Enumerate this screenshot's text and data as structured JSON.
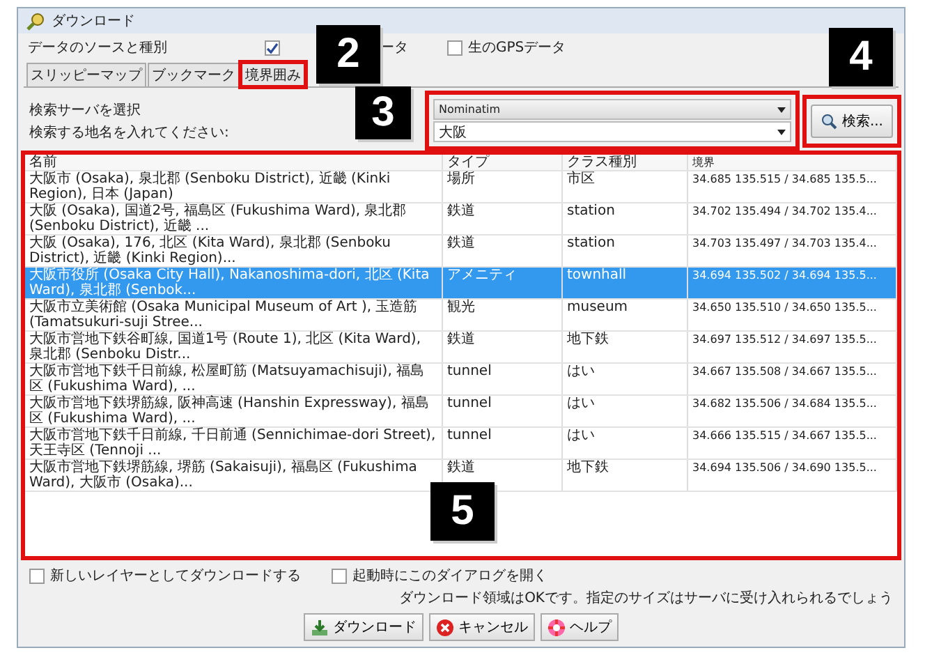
{
  "window": {
    "title": "ダウンロード"
  },
  "source": {
    "label": "データのソースと種別",
    "options": [
      {
        "label": "ータ",
        "checked": true
      },
      {
        "label": "生のGPSデータ",
        "checked": false
      }
    ]
  },
  "tabs": [
    {
      "label": "スリッピーマップ",
      "selected": false,
      "highlighted": false
    },
    {
      "label": "ブックマーク",
      "selected": false,
      "highlighted": false
    },
    {
      "label": "境界囲み",
      "selected": false,
      "highlighted": true
    }
  ],
  "search": {
    "server_label": "検索サーバを選択",
    "query_label": "検索する地名を入れてください:",
    "server": "Nominatim",
    "query": "大阪",
    "highlighted": true
  },
  "search_button": {
    "label": "検索...",
    "highlighted": true
  },
  "table": {
    "highlighted": true,
    "columns": [
      "名前",
      "タイプ",
      "クラス種別",
      "境界"
    ],
    "rows": [
      {
        "cells": [
          "大阪市 (Osaka), 泉北郡 (Senboku District), 近畿 (Kinki Region), 日本 (Japan)",
          "場所",
          "市区",
          "34.685 135.515 / 34.685 135.5..."
        ],
        "selected": false
      },
      {
        "cells": [
          "大阪 (Osaka), 国道2号, 福島区 (Fukushima Ward), 泉北郡 (Senboku District), 近畿 ...",
          "鉄道",
          "station",
          "34.702 135.494 / 34.702 135.4..."
        ],
        "selected": false
      },
      {
        "cells": [
          "大阪 (Osaka), 176, 北区 (Kita Ward), 泉北郡 (Senboku District), 近畿 (Kinki Region)...",
          "鉄道",
          "station",
          "34.703 135.497 / 34.703 135.4..."
        ],
        "selected": false
      },
      {
        "cells": [
          "大阪市役所 (Osaka City Hall), Nakanoshima-dori, 北区 (Kita Ward), 泉北郡 (Senbok...",
          "アメニティ",
          "townhall",
          "34.694 135.502 / 34.694 135.5..."
        ],
        "selected": true
      },
      {
        "cells": [
          "大阪市立美術館 (Osaka Municipal Museum of Art ), 玉造筋 (Tamatsukuri-suji Stree...",
          "観光",
          "museum",
          "34.650 135.510 / 34.650 135.5..."
        ],
        "selected": false
      },
      {
        "cells": [
          "大阪市営地下鉄谷町線, 国道1号 (Route 1), 北区 (Kita Ward), 泉北郡 (Senboku Distr...",
          "鉄道",
          "地下鉄",
          "34.697 135.512 / 34.697 135.5..."
        ],
        "selected": false
      },
      {
        "cells": [
          "大阪市営地下鉄千日前線, 松屋町筋 (Matsuyamachisuji), 福島区 (Fukushima Ward), ...",
          "tunnel",
          "はい",
          "34.667 135.508 / 34.667 135.5..."
        ],
        "selected": false
      },
      {
        "cells": [
          "大阪市営地下鉄堺筋線, 阪神高速 (Hanshin Expressway), 福島区 (Fukushima Ward), ...",
          "tunnel",
          "はい",
          "34.682 135.506 / 34.684 135.5..."
        ],
        "selected": false
      },
      {
        "cells": [
          "大阪市営地下鉄千日前線, 千日前通 (Sennichimae-dori Street), 天王寺区 (Tennoji ...",
          "tunnel",
          "はい",
          "34.666 135.515 / 34.667 135.5..."
        ],
        "selected": false
      },
      {
        "cells": [
          "大阪市営地下鉄堺筋線, 堺筋 (Sakaisuji), 福島区 (Fukushima Ward), 大阪市 (Osaka)...",
          "鉄道",
          "地下鉄",
          "34.694 135.506 / 34.690 135.5..."
        ],
        "selected": false
      }
    ]
  },
  "options": [
    {
      "label": "新しいレイヤーとしてダウンロードする",
      "checked": false
    },
    {
      "label": "起動時にこのダイアログを開く",
      "checked": false
    }
  ],
  "status": "ダウンロード領域はOKです。指定のサイズはサーバに受け入れられるでしょう",
  "buttons": [
    {
      "kind": "download",
      "label": "ダウンロード"
    },
    {
      "kind": "cancel",
      "label": "キャンセル"
    },
    {
      "kind": "help",
      "label": "ヘルプ"
    }
  ],
  "callouts": [
    {
      "label": "2"
    },
    {
      "label": "3"
    },
    {
      "label": "4"
    },
    {
      "label": "5"
    }
  ]
}
